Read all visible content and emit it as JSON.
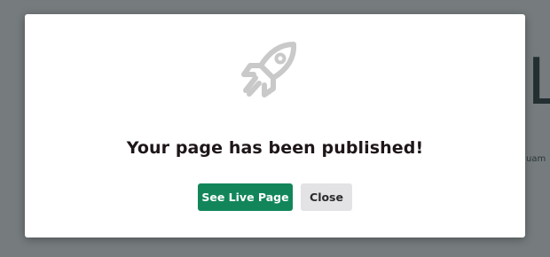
{
  "background": {
    "heading_fragment": "L",
    "text_fragment": "uam"
  },
  "modal": {
    "icon": "rocket-icon",
    "title": "Your page has been published!",
    "primary_button": "See Live Page",
    "secondary_button": "Close"
  },
  "colors": {
    "primary": "#12865a",
    "secondary": "#e3e2e4",
    "icon": "#c8c8c8"
  }
}
